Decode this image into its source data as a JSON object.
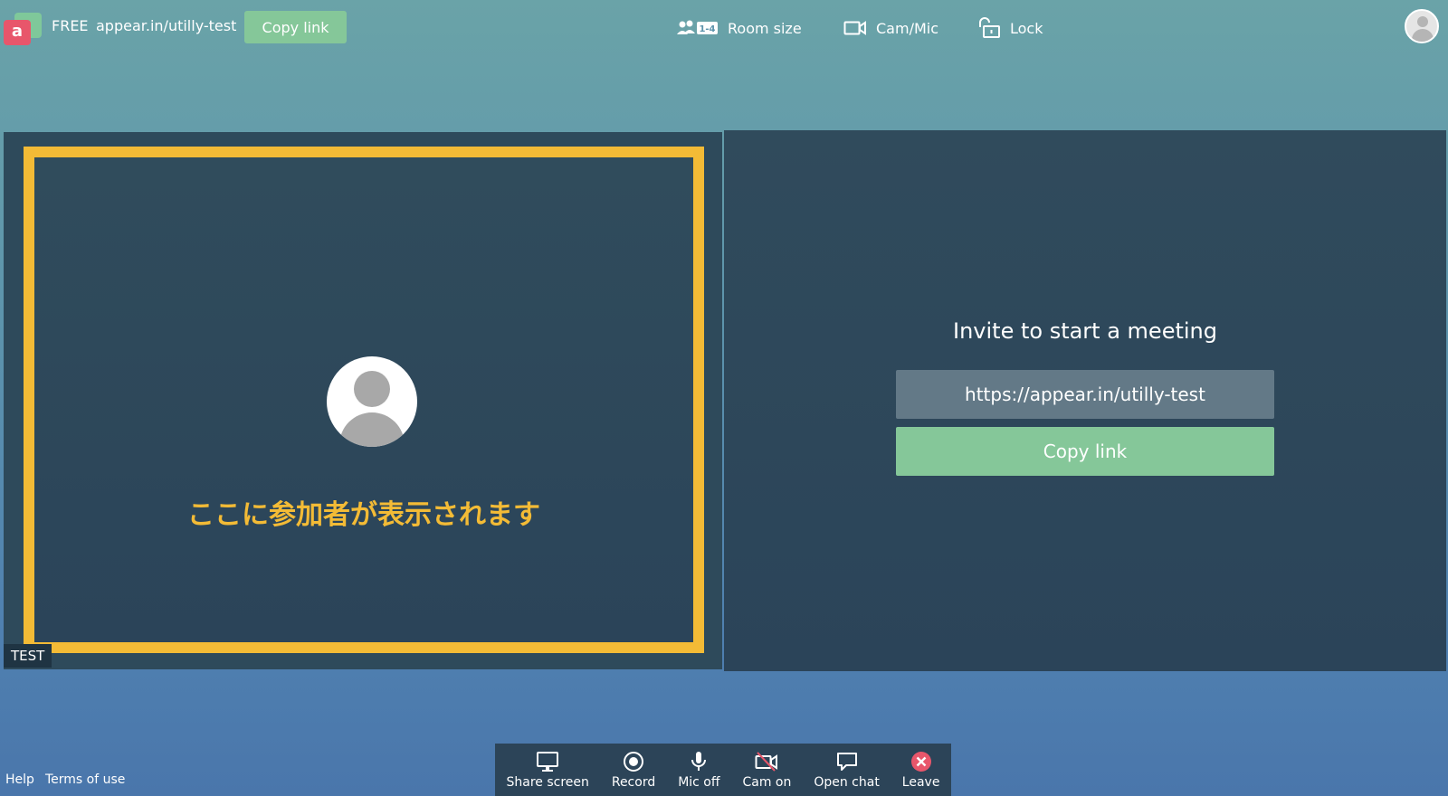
{
  "topbar": {
    "logo_letter": "a",
    "plan": "FREE",
    "room_name": "appear.in/utilly-test",
    "copy_link_label": "Copy link",
    "tools": [
      {
        "icon": "people-icon",
        "badge": "1-4",
        "label": "Room size"
      },
      {
        "icon": "camera-icon",
        "label": "Cam/Mic"
      },
      {
        "icon": "unlock-icon",
        "label": "Lock"
      }
    ]
  },
  "self_tile": {
    "note": "ここに参加者が表示されます",
    "name": "TEST"
  },
  "invite": {
    "title": "Invite to start a meeting",
    "url": "https://appear.in/utilly-test",
    "copy_label": "Copy link"
  },
  "footer": {
    "help": "Help",
    "terms": "Terms of use"
  },
  "controls": [
    {
      "icon": "monitor-icon",
      "label": "Share screen"
    },
    {
      "icon": "record-icon",
      "label": "Record"
    },
    {
      "icon": "microphone-icon",
      "label": "Mic off"
    },
    {
      "icon": "camera-off-icon",
      "label": "Cam on"
    },
    {
      "icon": "chat-icon",
      "label": "Open chat"
    },
    {
      "icon": "leave-icon",
      "label": "Leave"
    }
  ],
  "colors": {
    "accent_green": "#85c799",
    "highlight_yellow": "#f3bb36",
    "leave_red": "#e8566b",
    "tile_bg": "#2e4a5b"
  }
}
